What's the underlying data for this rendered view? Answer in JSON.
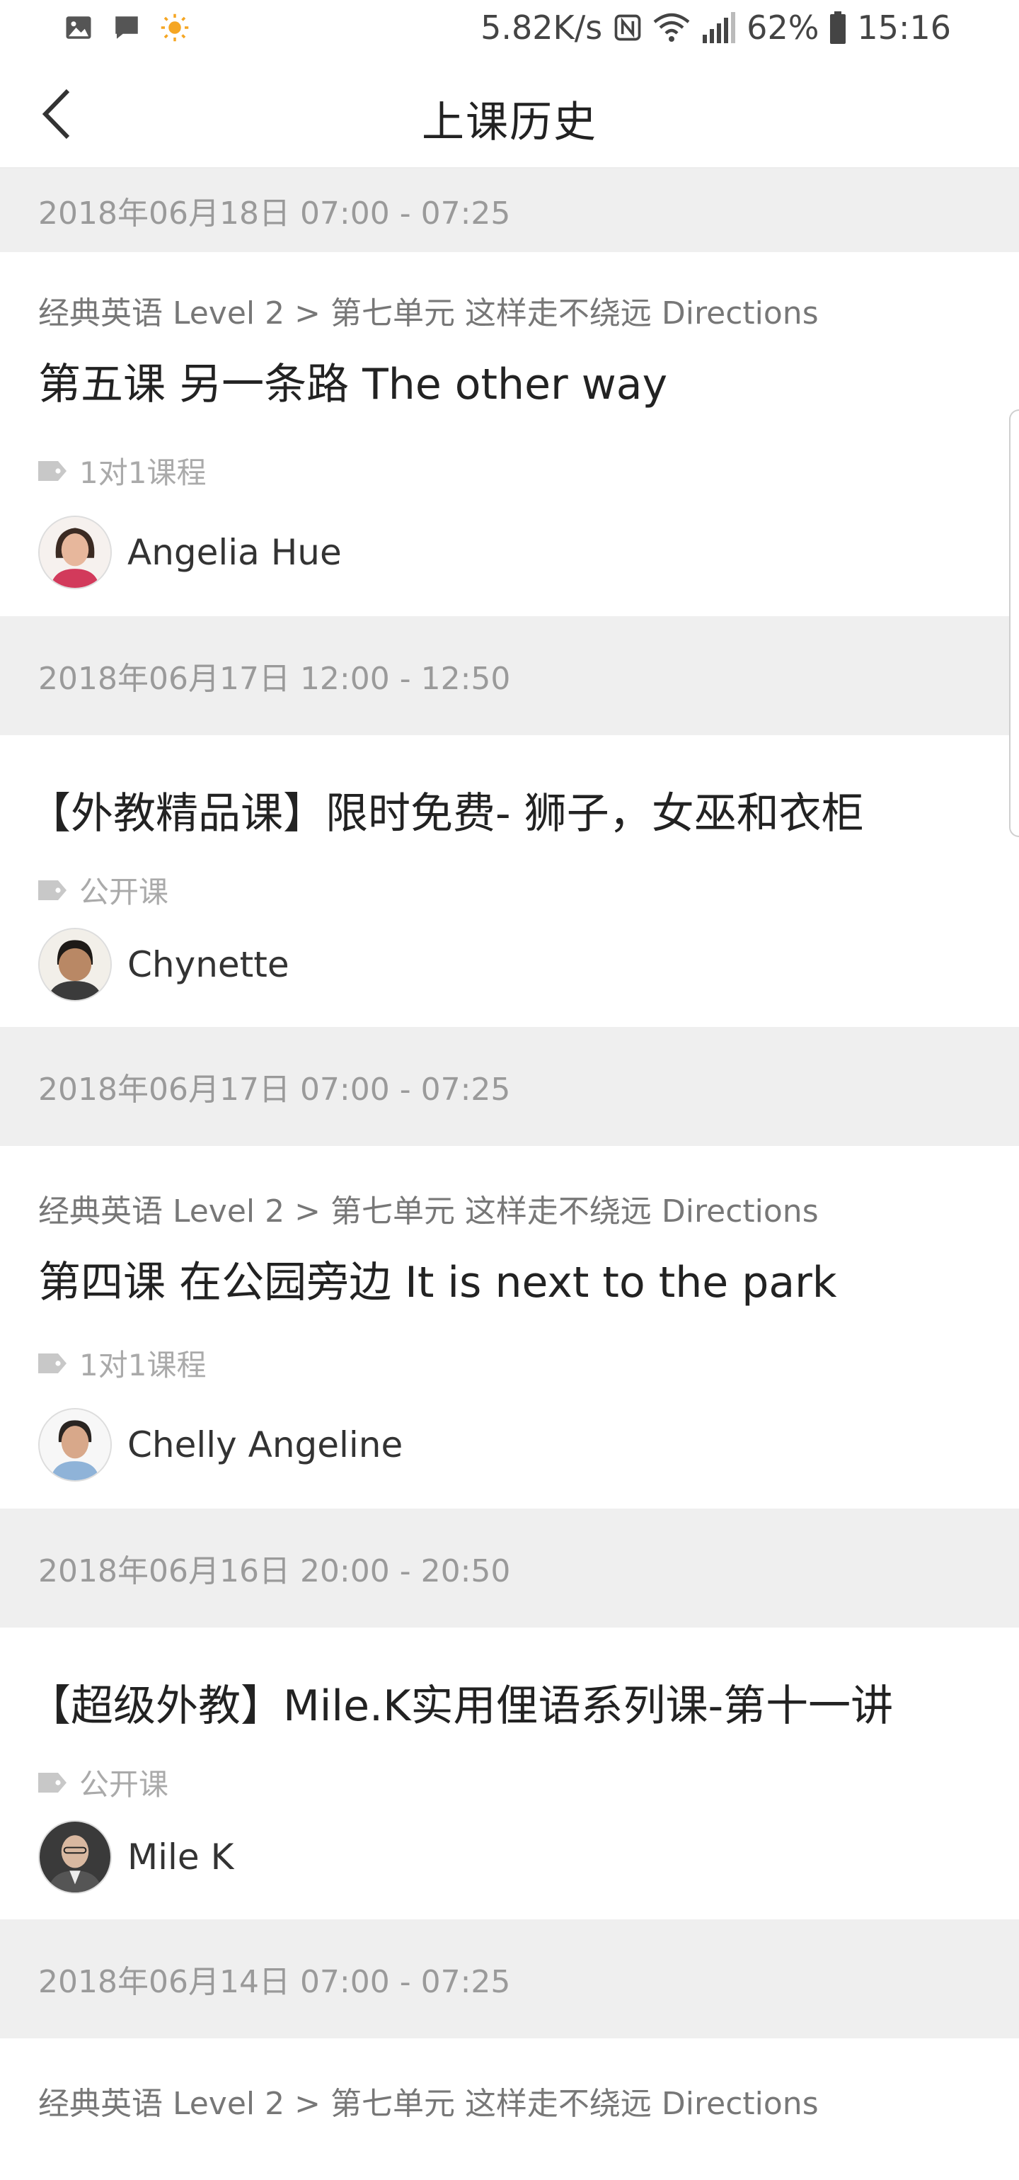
{
  "status_bar": {
    "speed": "5.82K/s",
    "signal": "4G",
    "battery": "62%",
    "time": "15:16",
    "icons": [
      "gallery-icon",
      "message-icon",
      "weather-icon",
      "nfc-icon",
      "wifi-icon",
      "signal-icon",
      "battery-icon"
    ]
  },
  "header": {
    "title": "上课历史",
    "back_icon": "chevron-left-icon"
  },
  "history": [
    {
      "date": "2018年06月18日 07:00 - 07:25",
      "course_path": "经典英语 Level 2 > 第七单元 这样走不绕远 Directions",
      "title": "第五课 另一条路 The other way",
      "tag": "1对1课程",
      "teacher": "Angelia Hue"
    },
    {
      "date": "2018年06月17日 12:00 - 12:50",
      "course_path": "",
      "title": "【外教精品课】限时免费- 狮子，女巫和衣柜",
      "tag": "公开课",
      "teacher": "Chynette"
    },
    {
      "date": "2018年06月17日 07:00 - 07:25",
      "course_path": "经典英语 Level 2 > 第七单元 这样走不绕远 Directions",
      "title": "第四课 在公园旁边 It is next to the park",
      "tag": "1对1课程",
      "teacher": "Chelly Angeline"
    },
    {
      "date": "2018年06月16日 20:00 - 20:50",
      "course_path": "",
      "title": "【超级外教】Mile.K实用俚语系列课-第十一讲",
      "tag": "公开课",
      "teacher": "Mile K"
    },
    {
      "date": "2018年06月14日 07:00 - 07:25",
      "course_path": "经典英语 Level 2 > 第七单元 这样走不绕远 Directions"
    }
  ],
  "colors": {
    "date_bg": "#efefef",
    "date_text": "#9a9a9a",
    "title_text": "#222222",
    "tag_text": "#aaaaaa"
  }
}
